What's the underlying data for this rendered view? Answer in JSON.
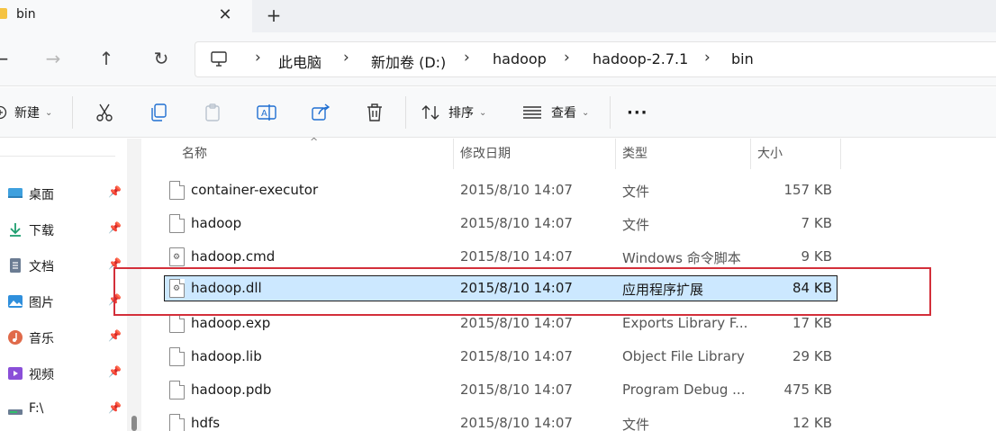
{
  "tab": {
    "title": "bin",
    "close": "✕",
    "add": "+"
  },
  "nav": {
    "back": "←",
    "forward": "→",
    "up": "↑",
    "refresh": "↻"
  },
  "breadcrumb": [
    "此电脑",
    "新加卷 (D:)",
    "hadoop",
    "hadoop-2.7.1",
    "bin"
  ],
  "breadcrumb_sep": "›",
  "commands": {
    "new_label": "新建",
    "sort_label": "排序",
    "view_label": "查看",
    "more": "···"
  },
  "sidebar": {
    "items": [
      {
        "label": "桌面",
        "icon": "desktop-icon"
      },
      {
        "label": "下载",
        "icon": "download-icon"
      },
      {
        "label": "文档",
        "icon": "document-icon"
      },
      {
        "label": "图片",
        "icon": "pictures-icon"
      },
      {
        "label": "音乐",
        "icon": "music-icon"
      },
      {
        "label": "视频",
        "icon": "video-icon"
      },
      {
        "label": "F:\\",
        "icon": "drive-icon"
      }
    ]
  },
  "columns": {
    "name": "名称",
    "date": "修改日期",
    "type": "类型",
    "size": "大小"
  },
  "files": [
    {
      "name": "container-executor",
      "date": "2015/8/10 14:07",
      "type": "文件",
      "size": "157 KB",
      "icon": "file-icon"
    },
    {
      "name": "hadoop",
      "date": "2015/8/10 14:07",
      "type": "文件",
      "size": "7 KB",
      "icon": "file-icon"
    },
    {
      "name": "hadoop.cmd",
      "date": "2015/8/10 14:07",
      "type": "Windows 命令脚本",
      "size": "9 KB",
      "icon": "script-file-icon"
    },
    {
      "name": "hadoop.dll",
      "date": "2015/8/10 14:07",
      "type": "应用程序扩展",
      "size": "84 KB",
      "icon": "dll-file-icon",
      "selected": true
    },
    {
      "name": "hadoop.exp",
      "date": "2015/8/10 14:07",
      "type": "Exports Library F...",
      "size": "17 KB",
      "icon": "file-icon"
    },
    {
      "name": "hadoop.lib",
      "date": "2015/8/10 14:07",
      "type": "Object File Library",
      "size": "29 KB",
      "icon": "file-icon"
    },
    {
      "name": "hadoop.pdb",
      "date": "2015/8/10 14:07",
      "type": "Program Debug ...",
      "size": "475 KB",
      "icon": "file-icon"
    },
    {
      "name": "hdfs",
      "date": "2015/8/10 14:07",
      "type": "文件",
      "size": "12 KB",
      "icon": "file-icon"
    }
  ],
  "colors": {
    "selection": "#cce8ff",
    "highlight_border": "#d32f3a",
    "accent": "#0078d4"
  }
}
